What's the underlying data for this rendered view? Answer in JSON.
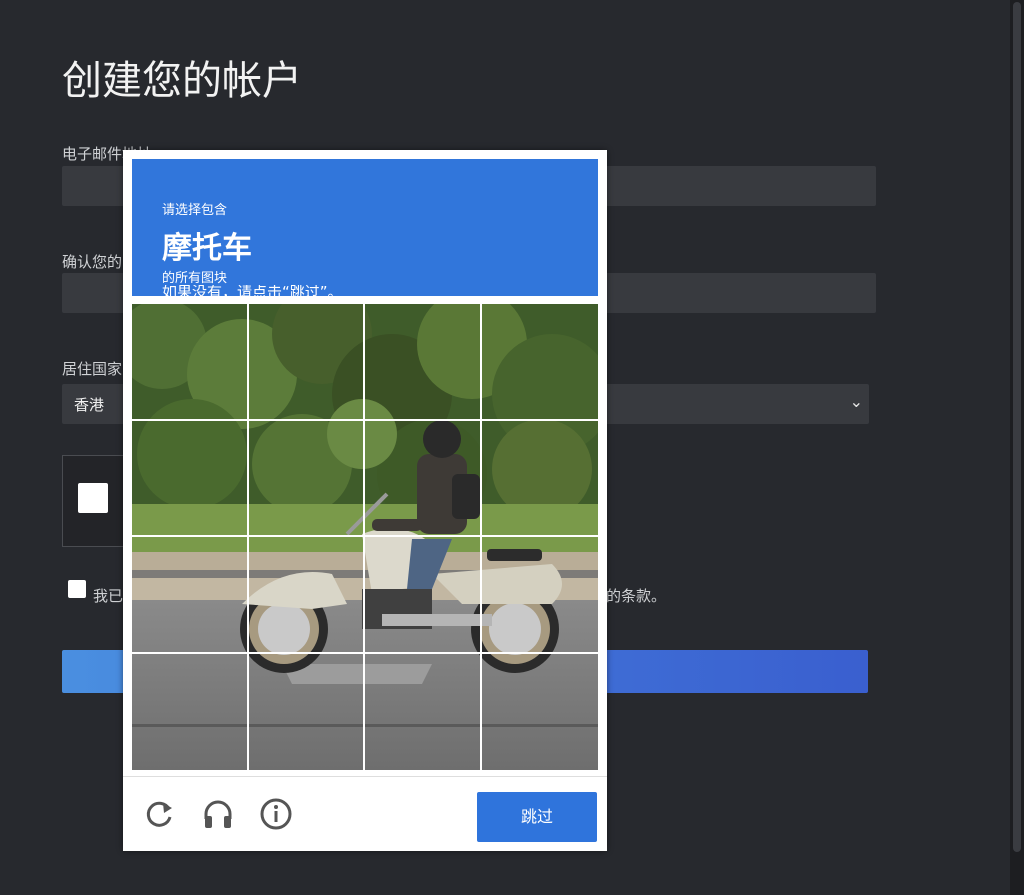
{
  "form": {
    "title": "创建您的帐户",
    "email_label": "电子邮件地址",
    "confirm_label": "确认您的",
    "country_label": "居住国家",
    "country_value": "香港",
    "terms_prefix": "我已",
    "terms_suffix": "的条款。"
  },
  "challenge": {
    "instruction_line1": "请选择包含",
    "target_object": "摩托车",
    "instruction_line3": "的所有图块",
    "instruction_line4": "如果没有，请点击“跳过”。",
    "grid_rows": 4,
    "grid_cols": 4,
    "footer": {
      "reload_icon": "reload-icon",
      "audio_icon": "headphones-icon",
      "info_icon": "info-icon",
      "skip_label": "跳过"
    }
  },
  "colors": {
    "page_bg": "#27292e",
    "field_bg": "#383a3f",
    "challenge_header": "#3176db",
    "skip_button": "#2f74dc"
  }
}
